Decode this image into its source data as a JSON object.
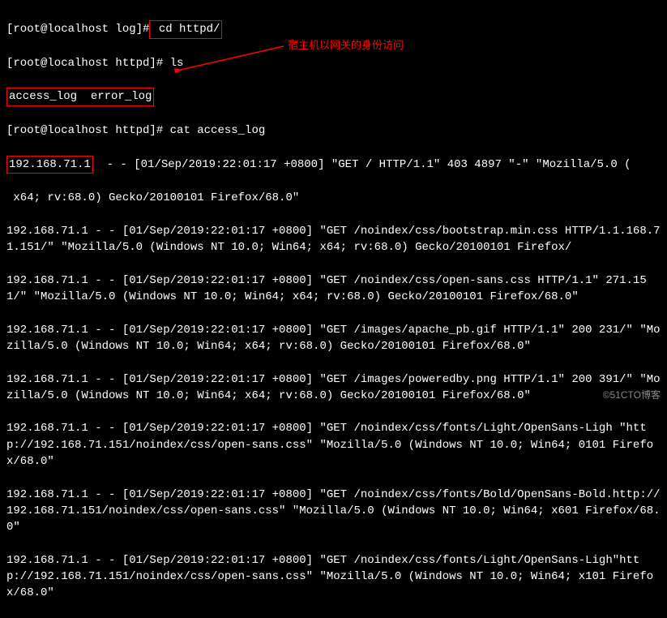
{
  "prompt": {
    "p1": "[root@localhost log]#",
    "p2": "[root@localhost httpd]#",
    "cmd_cd": " cd httpd/",
    "cmd_ls": " ls",
    "cmd_cat": " cat access_log"
  },
  "ls_output": "access_log  error_log",
  "annotation": "宿主机以网关的身份访问",
  "highlight_ip": "192.168.71.1",
  "log": {
    "l1_rest": "  - - [01/Sep/2019:22:01:17 +0800] \"GET / HTTP/1.1\" 403 4897 \"-\" \"Mozilla/5.0 (",
    "l1b": " x64; rv:68.0) Gecko/20100101 Firefox/68.0\"",
    "l2": "192.168.71.1 - - [01/Sep/2019:22:01:17 +0800] \"GET /noindex/css/bootstrap.min.css HTTP/1.1.168.71.151/\" \"Mozilla/5.0 (Windows NT 10.0; Win64; x64; rv:68.0) Gecko/20100101 Firefox/",
    "l3": "192.168.71.1 - - [01/Sep/2019:22:01:17 +0800] \"GET /noindex/css/open-sans.css HTTP/1.1\" 271.151/\" \"Mozilla/5.0 (Windows NT 10.0; Win64; x64; rv:68.0) Gecko/20100101 Firefox/68.0\"",
    "l4": "192.168.71.1 - - [01/Sep/2019:22:01:17 +0800] \"GET /images/apache_pb.gif HTTP/1.1\" 200 231/\" \"Mozilla/5.0 (Windows NT 10.0; Win64; x64; rv:68.0) Gecko/20100101 Firefox/68.0\"",
    "l5": "192.168.71.1 - - [01/Sep/2019:22:01:17 +0800] \"GET /images/poweredby.png HTTP/1.1\" 200 391/\" \"Mozilla/5.0 (Windows NT 10.0; Win64; x64; rv:68.0) Gecko/20100101 Firefox/68.0\"",
    "l6": "192.168.71.1 - - [01/Sep/2019:22:01:17 +0800] \"GET /noindex/css/fonts/Light/OpenSans-Ligh \"http://192.168.71.151/noindex/css/open-sans.css\" \"Mozilla/5.0 (Windows NT 10.0; Win64; 0101 Firefox/68.0\"",
    "l7": "192.168.71.1 - - [01/Sep/2019:22:01:17 +0800] \"GET /noindex/css/fonts/Bold/OpenSans-Bold.http://192.168.71.151/noindex/css/open-sans.css\" \"Mozilla/5.0 (Windows NT 10.0; Win64; x601 Firefox/68.0\"",
    "l8": "192.168.71.1 - - [01/Sep/2019:22:01:17 +0800] \"GET /noindex/css/fonts/Light/OpenSans-Ligh\"http://192.168.71.151/noindex/css/open-sans.css\" \"Mozilla/5.0 (Windows NT 10.0; Win64; x101 Firefox/68.0\""
  },
  "watermark": "©51CTO博客"
}
